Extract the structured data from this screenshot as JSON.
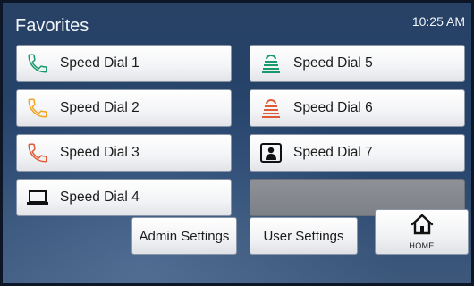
{
  "header": {
    "title": "Favorites",
    "time": "10:25 AM"
  },
  "speed_dials": [
    {
      "label": "Speed Dial 1",
      "icon": "phone-icon",
      "color": "#1a9a6c"
    },
    {
      "label": "Speed Dial 2",
      "icon": "phone-icon",
      "color": "#f0a623"
    },
    {
      "label": "Speed Dial 3",
      "icon": "phone-icon",
      "color": "#e05a36"
    },
    {
      "label": "Speed Dial 4",
      "icon": "laptop-icon",
      "color": "#111111"
    },
    {
      "label": "Speed Dial 5",
      "icon": "speaker-icon",
      "color": "#1a9a6c"
    },
    {
      "label": "Speed Dial 6",
      "icon": "speaker-icon",
      "color": "#e05a36"
    },
    {
      "label": "Speed Dial 7",
      "icon": "contact-icon",
      "color": "#111111"
    }
  ],
  "footer": {
    "admin_settings": "Admin Settings",
    "user_settings": "User Settings",
    "home": "HOME"
  }
}
